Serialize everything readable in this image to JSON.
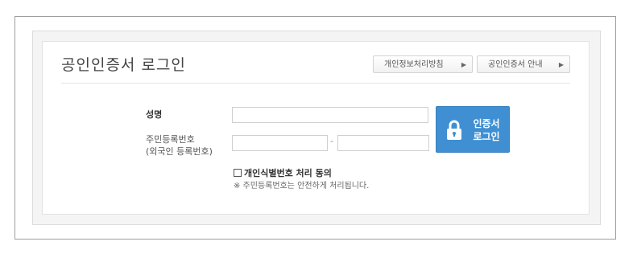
{
  "panel": {
    "title": "공인인증서 로그인",
    "privacy_button": "개인정보처리방침",
    "guide_button": "공인인증서 안내",
    "arrow_glyph": "▶"
  },
  "form": {
    "name_label": "성명",
    "rrn_label_line1": "주민등록번호",
    "rrn_label_line2": "(외국인 등록번호)",
    "name_value": "",
    "rrn_first_value": "",
    "rrn_second_value": "",
    "rrn_separator": "-"
  },
  "login_button": {
    "line1": "인증서",
    "line2": "로그인",
    "icon": "lock-icon",
    "color": "#3f8fd2"
  },
  "consent": {
    "label": "개인식별번호 처리 동의",
    "checked": false
  },
  "note": "※ 주민등록번호는 안전하게 처리됩니다."
}
